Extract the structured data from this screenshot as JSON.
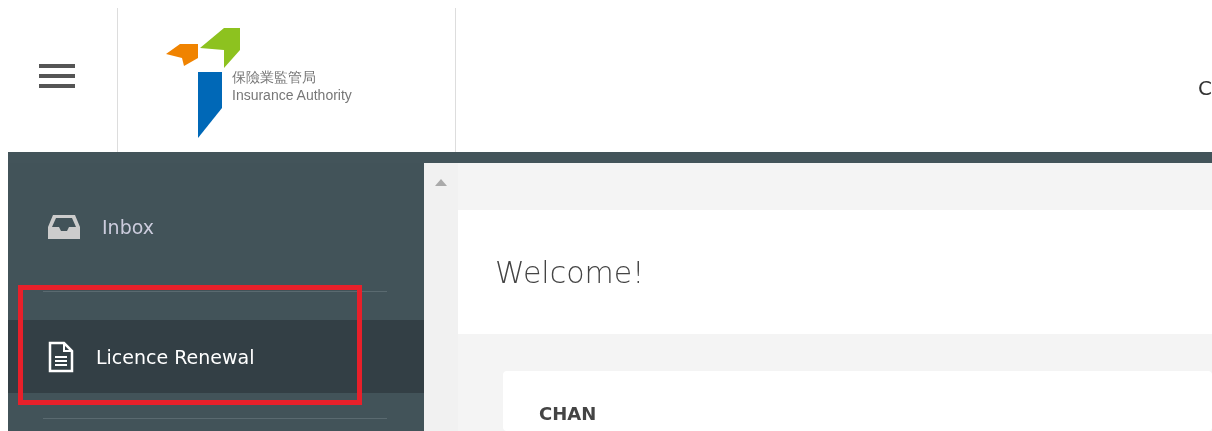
{
  "header": {
    "logo": {
      "chinese": "保險業監管局",
      "english": "Insurance Authority"
    },
    "text_right": "C"
  },
  "sidebar": {
    "items": [
      {
        "label": "Inbox",
        "kind": "inbox",
        "selected": false
      },
      {
        "label": "Licence Renewal",
        "kind": "document",
        "selected": true
      }
    ]
  },
  "main": {
    "title": "Welcome!",
    "card": {
      "title": "CHAN"
    }
  }
}
